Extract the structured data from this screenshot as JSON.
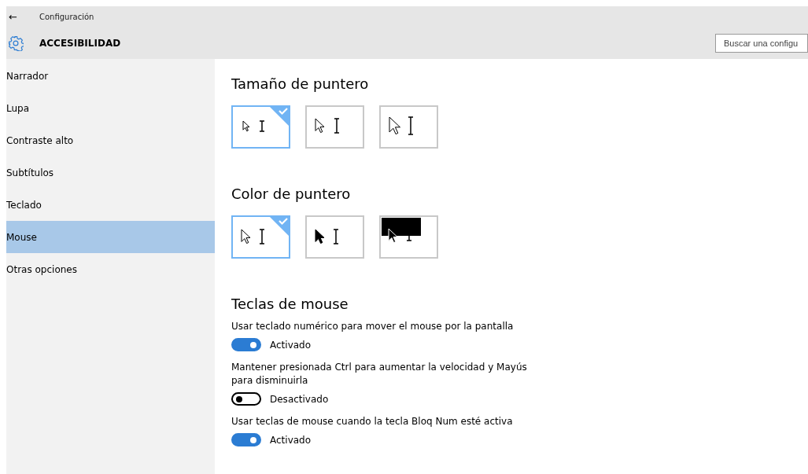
{
  "window": {
    "back": "←",
    "title": "Configuración"
  },
  "header": {
    "title": "ACCESIBILIDAD",
    "search": {
      "placeholder": "Buscar una configu"
    }
  },
  "sidebar": {
    "items": [
      {
        "label": "Narrador",
        "selected": false
      },
      {
        "label": "Lupa",
        "selected": false
      },
      {
        "label": "Contraste alto",
        "selected": false
      },
      {
        "label": "Subtítulos",
        "selected": false
      },
      {
        "label": "Teclado",
        "selected": false
      },
      {
        "label": "Mouse",
        "selected": true
      },
      {
        "label": "Otras opciones",
        "selected": false
      }
    ]
  },
  "pointer_size": {
    "heading": "Tamaño de puntero",
    "options": [
      {
        "kind": "small",
        "selected": true
      },
      {
        "kind": "medium",
        "selected": false
      },
      {
        "kind": "large",
        "selected": false
      }
    ]
  },
  "pointer_color": {
    "heading": "Color de puntero",
    "options": [
      {
        "kind": "white",
        "selected": true
      },
      {
        "kind": "black",
        "selected": false
      },
      {
        "kind": "inverted",
        "selected": false
      }
    ]
  },
  "mouse_keys": {
    "heading": "Teclas de mouse",
    "settings": [
      {
        "label": "Usar teclado numérico para mover el mouse por la pantalla",
        "on": true,
        "state": "Activado"
      },
      {
        "label": "Mantener presionada Ctrl para aumentar la velocidad y Mayús para disminuirla",
        "on": false,
        "state": "Desactivado"
      },
      {
        "label": "Usar teclas de mouse cuando la tecla Bloq Num esté activa",
        "on": true,
        "state": "Activado"
      }
    ]
  }
}
